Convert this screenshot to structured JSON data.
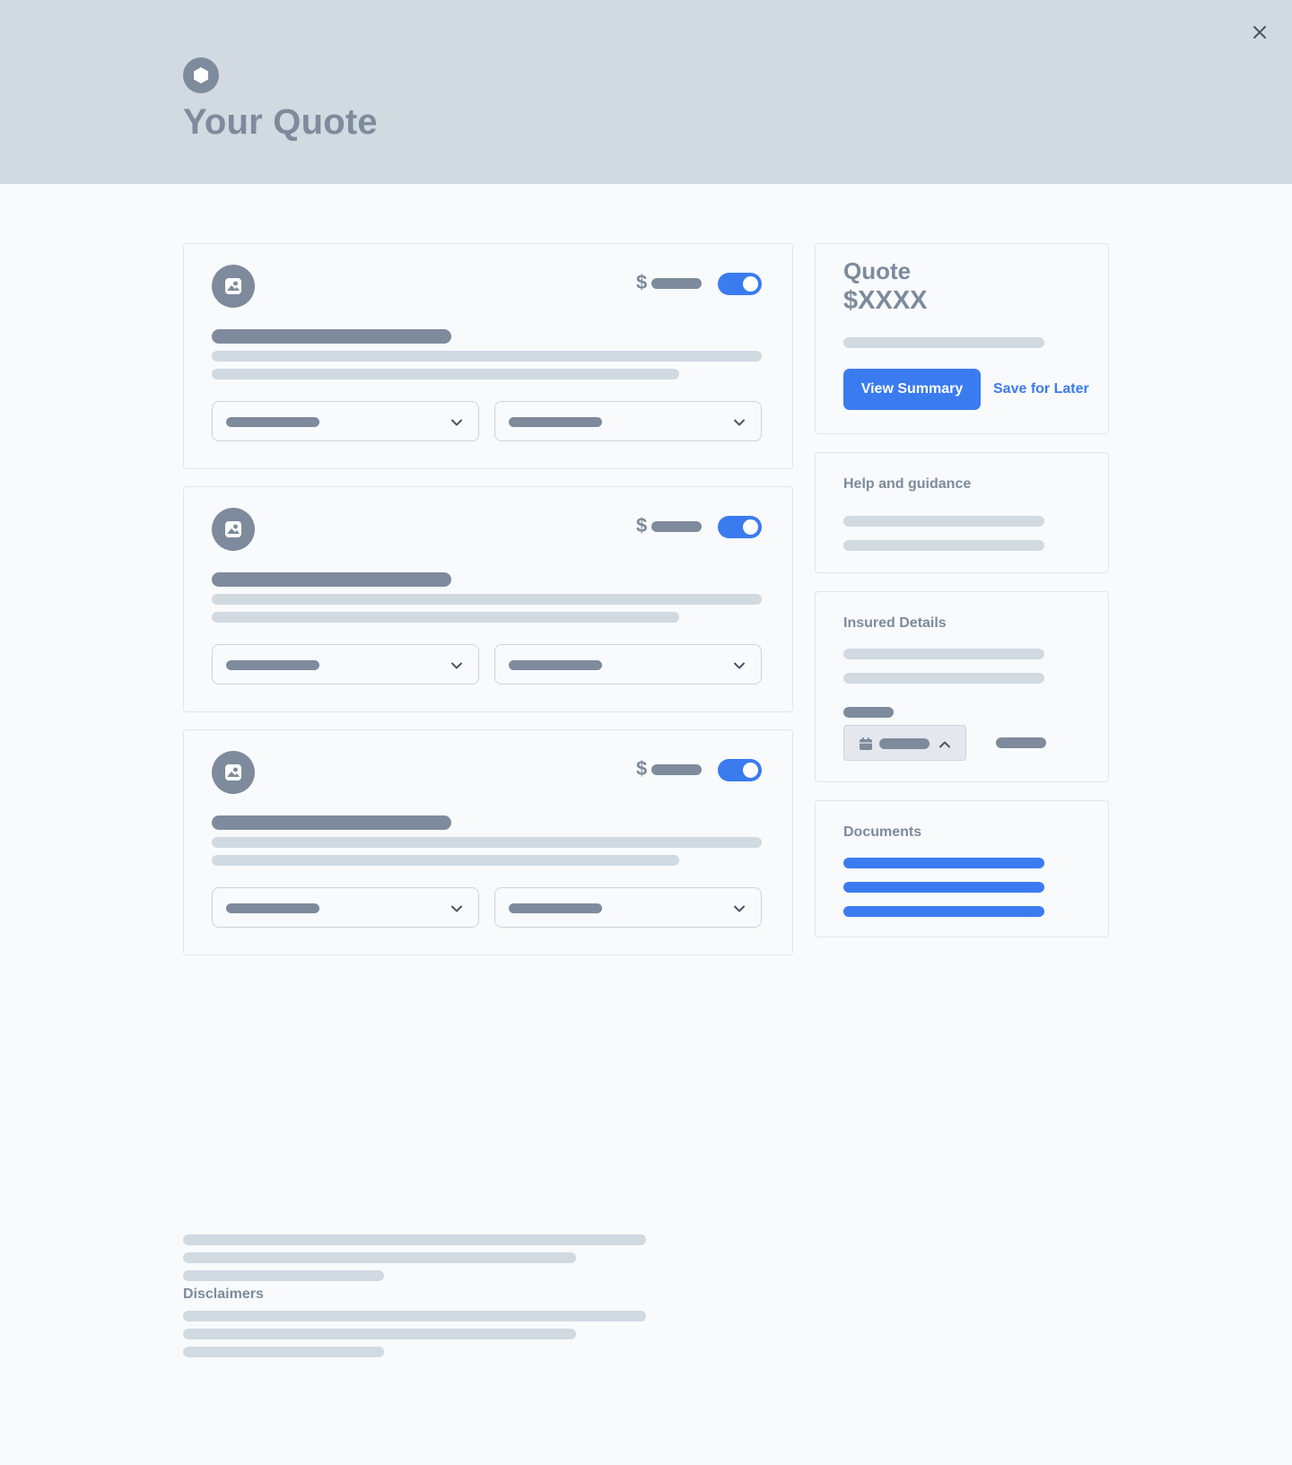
{
  "header": {
    "title": "Your Quote",
    "logo_icon": "hexagon-icon",
    "close_icon": "close-icon"
  },
  "coverage_cards": [
    {
      "currency_symbol": "$",
      "toggle_on": true,
      "icon": "image-icon"
    },
    {
      "currency_symbol": "$",
      "toggle_on": true,
      "icon": "image-icon"
    },
    {
      "currency_symbol": "$",
      "toggle_on": true,
      "icon": "image-icon"
    }
  ],
  "quote_panel": {
    "label": "Quote",
    "amount": "$XXXX",
    "view_summary_label": "View Summary",
    "save_for_later_label": "Save for Later"
  },
  "help_panel": {
    "title": "Help and guidance"
  },
  "insured_panel": {
    "title": "Insured Details",
    "calendar_icon": "calendar-icon"
  },
  "documents_panel": {
    "title": "Documents",
    "link_count": 3
  },
  "footer": {
    "disclaimers_label": "Disclaimers"
  },
  "colors": {
    "accent": "#3b7bf0",
    "header_bg": "#d1d9e1",
    "muted": "#7d8b9c",
    "placeholder": "#d1d9e1"
  }
}
